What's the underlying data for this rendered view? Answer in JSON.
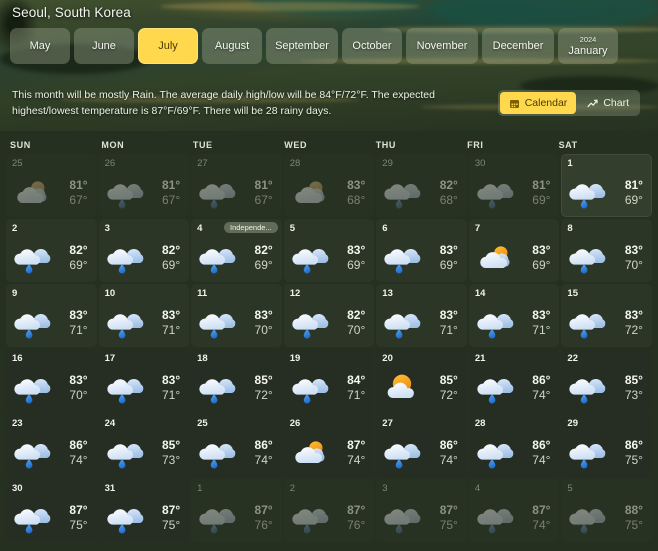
{
  "header": {
    "location": "Seoul, South Korea"
  },
  "months": [
    {
      "label": "May",
      "year": "",
      "active": false
    },
    {
      "label": "June",
      "year": "",
      "active": false
    },
    {
      "label": "July",
      "year": "",
      "active": true
    },
    {
      "label": "August",
      "year": "",
      "active": false
    },
    {
      "label": "September",
      "year": "",
      "active": false
    },
    {
      "label": "October",
      "year": "",
      "active": false
    },
    {
      "label": "November",
      "year": "",
      "active": false
    },
    {
      "label": "December",
      "year": "",
      "active": false
    },
    {
      "label": "January",
      "year": "2024",
      "active": false
    }
  ],
  "summary": {
    "text": "This month will be mostly Rain. The average daily high/low will be 84°F/72°F. The expected highest/lowest temperature is 87°F/69°F. There will be 28 rainy days.",
    "view_buttons": [
      {
        "label": "Calendar",
        "icon": "calendar-icon",
        "active": true
      },
      {
        "label": "Chart",
        "icon": "chart-icon",
        "active": false
      }
    ]
  },
  "calendar": {
    "weekdays": [
      "SUN",
      "MON",
      "TUE",
      "WED",
      "THU",
      "FRI",
      "SAT"
    ],
    "accent_color": "#ffd84d",
    "weeks": [
      [
        {
          "num": "25",
          "hi": "81°",
          "lo": "67°",
          "icon": "sun-behind-cloud",
          "other": true
        },
        {
          "num": "26",
          "hi": "81°",
          "lo": "67°",
          "icon": "rain-cloud",
          "other": true
        },
        {
          "num": "27",
          "hi": "81°",
          "lo": "67°",
          "icon": "rain-cloud",
          "other": true
        },
        {
          "num": "28",
          "hi": "83°",
          "lo": "68°",
          "icon": "sun-behind-cloud",
          "other": true
        },
        {
          "num": "29",
          "hi": "82°",
          "lo": "68°",
          "icon": "rain-cloud",
          "other": true
        },
        {
          "num": "30",
          "hi": "81°",
          "lo": "69°",
          "icon": "rain-cloud",
          "other": true
        },
        {
          "num": "1",
          "hi": "81°",
          "lo": "69°",
          "icon": "rain-cloud",
          "other": false,
          "today": true
        }
      ],
      [
        {
          "num": "2",
          "hi": "82°",
          "lo": "69°",
          "icon": "rain-cloud",
          "other": false
        },
        {
          "num": "3",
          "hi": "82°",
          "lo": "69°",
          "icon": "rain-cloud",
          "other": false
        },
        {
          "num": "4",
          "hi": "82°",
          "lo": "69°",
          "icon": "rain-cloud",
          "other": false,
          "holiday": "Independe..."
        },
        {
          "num": "5",
          "hi": "83°",
          "lo": "69°",
          "icon": "rain-cloud",
          "other": false
        },
        {
          "num": "6",
          "hi": "83°",
          "lo": "69°",
          "icon": "rain-cloud",
          "other": false
        },
        {
          "num": "7",
          "hi": "83°",
          "lo": "69°",
          "icon": "sun-behind-cloud",
          "other": false
        },
        {
          "num": "8",
          "hi": "83°",
          "lo": "70°",
          "icon": "rain-cloud",
          "other": false
        }
      ],
      [
        {
          "num": "9",
          "hi": "83°",
          "lo": "71°",
          "icon": "rain-cloud",
          "other": false
        },
        {
          "num": "10",
          "hi": "83°",
          "lo": "71°",
          "icon": "rain-cloud",
          "other": false
        },
        {
          "num": "11",
          "hi": "83°",
          "lo": "70°",
          "icon": "rain-cloud",
          "other": false
        },
        {
          "num": "12",
          "hi": "82°",
          "lo": "70°",
          "icon": "rain-cloud",
          "other": false
        },
        {
          "num": "13",
          "hi": "83°",
          "lo": "71°",
          "icon": "rain-cloud",
          "other": false
        },
        {
          "num": "14",
          "hi": "83°",
          "lo": "71°",
          "icon": "rain-cloud",
          "other": false
        },
        {
          "num": "15",
          "hi": "83°",
          "lo": "72°",
          "icon": "rain-cloud",
          "other": false
        }
      ],
      [
        {
          "num": "16",
          "hi": "83°",
          "lo": "70°",
          "icon": "rain-cloud",
          "other": false
        },
        {
          "num": "17",
          "hi": "83°",
          "lo": "71°",
          "icon": "rain-cloud",
          "other": false
        },
        {
          "num": "18",
          "hi": "85°",
          "lo": "72°",
          "icon": "rain-cloud",
          "other": false
        },
        {
          "num": "19",
          "hi": "84°",
          "lo": "71°",
          "icon": "rain-cloud",
          "other": false
        },
        {
          "num": "20",
          "hi": "85°",
          "lo": "72°",
          "icon": "sun-mostly",
          "other": false
        },
        {
          "num": "21",
          "hi": "86°",
          "lo": "74°",
          "icon": "rain-cloud",
          "other": false
        },
        {
          "num": "22",
          "hi": "85°",
          "lo": "73°",
          "icon": "rain-cloud",
          "other": false
        }
      ],
      [
        {
          "num": "23",
          "hi": "86°",
          "lo": "74°",
          "icon": "rain-cloud",
          "other": false
        },
        {
          "num": "24",
          "hi": "85°",
          "lo": "73°",
          "icon": "rain-cloud",
          "other": false
        },
        {
          "num": "25",
          "hi": "86°",
          "lo": "74°",
          "icon": "rain-cloud",
          "other": false
        },
        {
          "num": "26",
          "hi": "87°",
          "lo": "74°",
          "icon": "sun-behind-cloud",
          "other": false
        },
        {
          "num": "27",
          "hi": "86°",
          "lo": "74°",
          "icon": "rain-cloud",
          "other": false
        },
        {
          "num": "28",
          "hi": "86°",
          "lo": "74°",
          "icon": "rain-cloud",
          "other": false
        },
        {
          "num": "29",
          "hi": "86°",
          "lo": "75°",
          "icon": "rain-cloud",
          "other": false
        }
      ],
      [
        {
          "num": "30",
          "hi": "87°",
          "lo": "75°",
          "icon": "rain-cloud",
          "other": false
        },
        {
          "num": "31",
          "hi": "87°",
          "lo": "75°",
          "icon": "rain-cloud",
          "other": false
        },
        {
          "num": "1",
          "hi": "87°",
          "lo": "76°",
          "icon": "rain-cloud",
          "other": true
        },
        {
          "num": "2",
          "hi": "87°",
          "lo": "76°",
          "icon": "rain-cloud",
          "other": true
        },
        {
          "num": "3",
          "hi": "87°",
          "lo": "75°",
          "icon": "rain-cloud",
          "other": true
        },
        {
          "num": "4",
          "hi": "87°",
          "lo": "74°",
          "icon": "rain-cloud",
          "other": true
        },
        {
          "num": "5",
          "hi": "88°",
          "lo": "75°",
          "icon": "rain-cloud",
          "other": true
        }
      ]
    ]
  }
}
